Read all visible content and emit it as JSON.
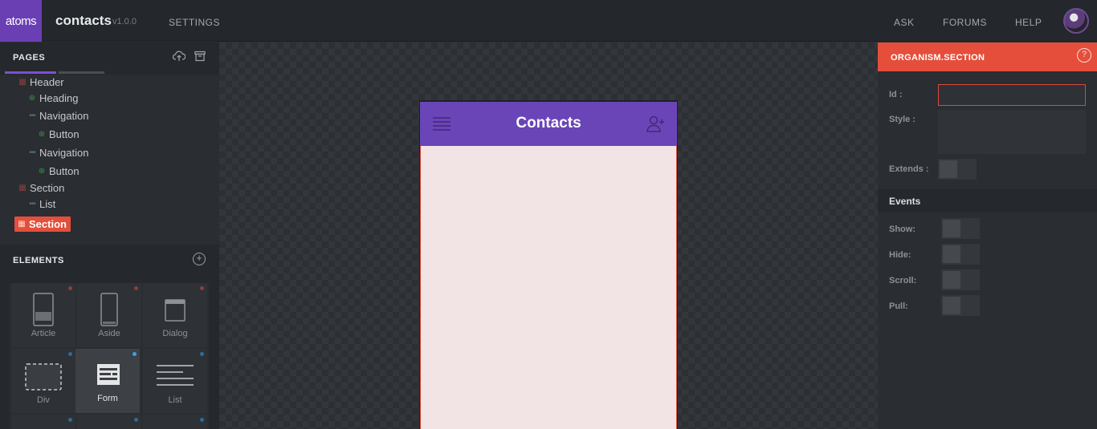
{
  "topbar": {
    "logo": "atoms",
    "app_title": "contacts",
    "version": "v1.0.0",
    "settings": "SETTINGS",
    "ask": "ASK",
    "forums": "FORUMS",
    "help": "HELP"
  },
  "pages": {
    "title": "PAGES",
    "tree": [
      {
        "label": "Header",
        "icon": "grid-icon"
      },
      {
        "label": "Heading",
        "icon": "plus-circle-icon"
      },
      {
        "label": "Navigation",
        "icon": "dots-icon"
      },
      {
        "label": "Button",
        "icon": "plus-circle-icon"
      },
      {
        "label": "Navigation",
        "icon": "dots-icon"
      },
      {
        "label": "Button",
        "icon": "plus-circle-icon"
      },
      {
        "label": "Section",
        "icon": "grid-icon"
      },
      {
        "label": "List",
        "icon": "dots-icon"
      },
      {
        "label": "Section",
        "icon": "grid-icon",
        "selected": true
      }
    ]
  },
  "elements": {
    "title": "ELEMENTS",
    "tiles": [
      {
        "label": "Article",
        "dot_color": "#8c3e3e"
      },
      {
        "label": "Aside",
        "dot_color": "#8c3e3e"
      },
      {
        "label": "Dialog",
        "dot_color": "#8c3e3e"
      },
      {
        "label": "Div",
        "dot_color": "#2f6b9a"
      },
      {
        "label": "Form",
        "dot_color": "#3ea0ea",
        "active": true
      },
      {
        "label": "List",
        "dot_color": "#2f6b9a"
      }
    ]
  },
  "canvas": {
    "phone_title": "Contacts"
  },
  "inspector": {
    "title": "ORGANISM.SECTION",
    "help": "?",
    "id_label": "Id :",
    "id_value": "",
    "style_label": "Style :",
    "style_value": "",
    "extends_label": "Extends :",
    "events_title": "Events",
    "events": [
      {
        "label": "Show:"
      },
      {
        "label": "Hide:"
      },
      {
        "label": "Scroll:"
      },
      {
        "label": "Pull:"
      }
    ]
  },
  "colors": {
    "accent_purple": "#6a45b8",
    "accent_red": "#e44e3b"
  }
}
